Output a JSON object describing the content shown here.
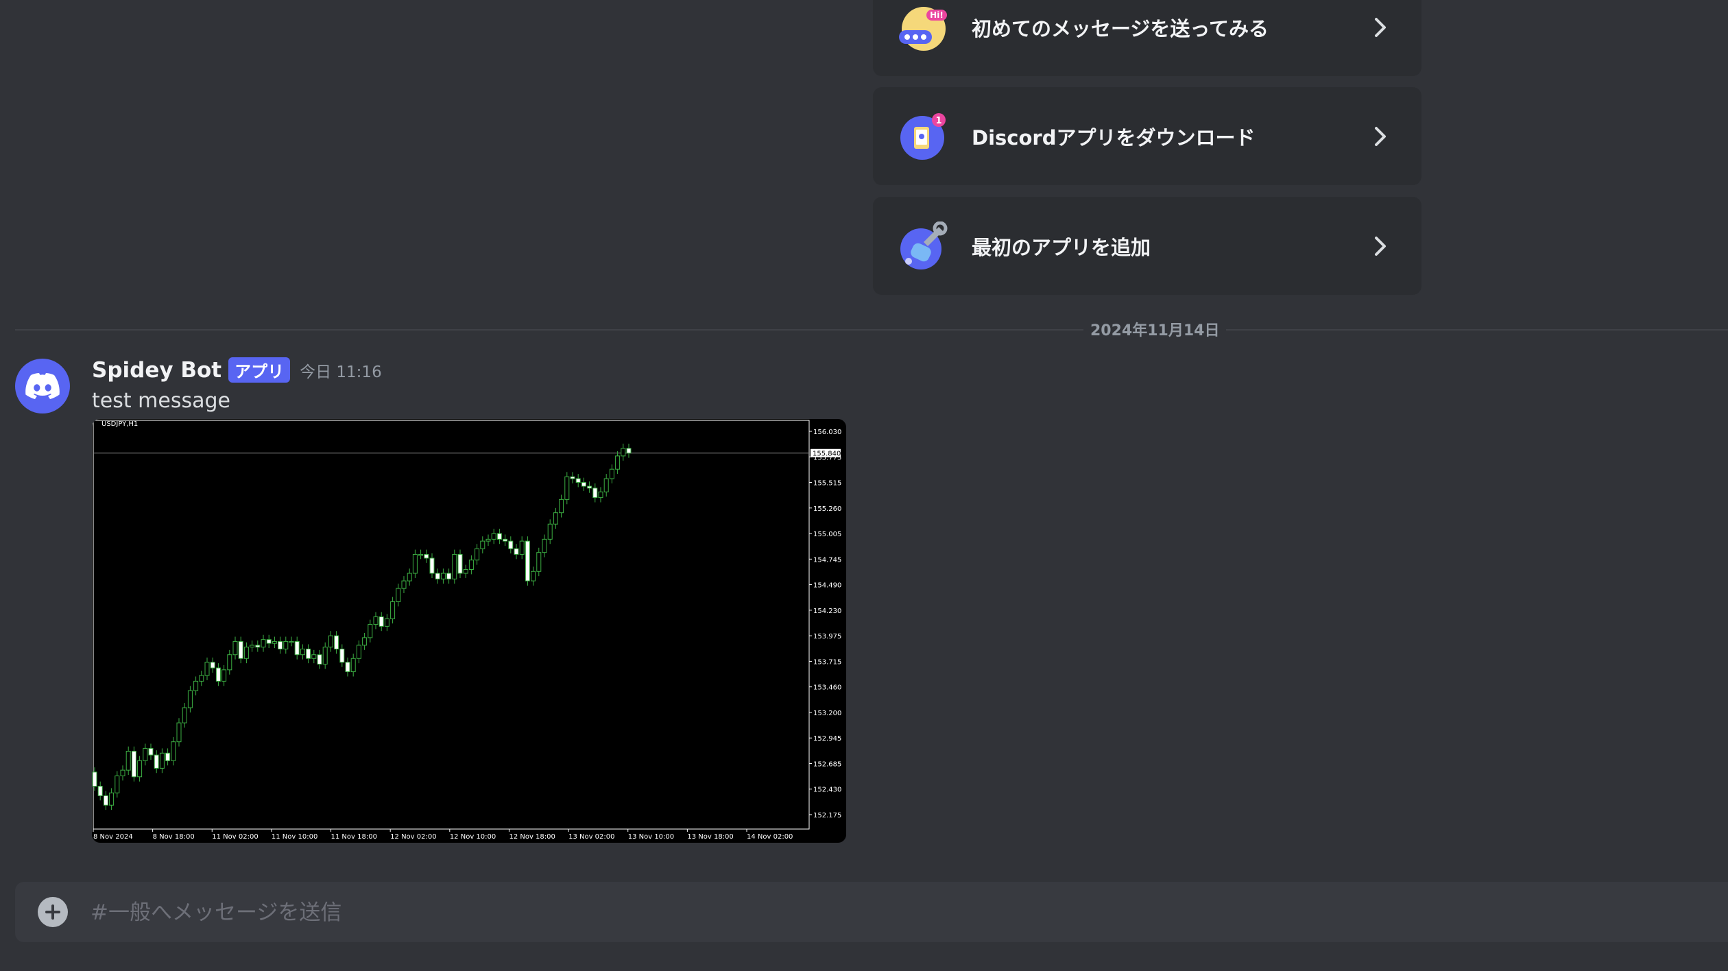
{
  "onboarding": {
    "cards": [
      {
        "label": "初めてのメッセージを送ってみる",
        "icon": "wave-chat-icon"
      },
      {
        "label": "Discordアプリをダウンロード",
        "icon": "phone-download-icon",
        "badge": "1"
      },
      {
        "label": "最初のアプリを追加",
        "icon": "wrench-app-icon"
      }
    ],
    "hi_badge": "Hi!"
  },
  "divider": {
    "date": "2024年11月14日"
  },
  "message": {
    "username": "Spidey Bot",
    "badge": "アプリ",
    "timestamp": "今日 11:16",
    "text": "test message"
  },
  "chart_data": {
    "type": "candlestick",
    "title": "USDJPY,H1",
    "current_price_label": "155.840",
    "y_ticks": [
      "156.030",
      "155.775",
      "155.515",
      "155.260",
      "155.005",
      "154.745",
      "154.490",
      "154.230",
      "153.975",
      "153.715",
      "153.460",
      "153.200",
      "152.945",
      "152.685",
      "152.430",
      "152.175"
    ],
    "x_ticks": [
      "8 Nov 2024",
      "8 Nov 18:00",
      "11 Nov 02:00",
      "11 Nov 10:00",
      "11 Nov 18:00",
      "12 Nov 02:00",
      "12 Nov 10:00",
      "12 Nov 18:00",
      "13 Nov 02:00",
      "13 Nov 10:00",
      "13 Nov 18:00",
      "14 Nov 02:00"
    ],
    "ylim": [
      152.05,
      156.1
    ],
    "grid": false,
    "colors": {
      "up": "#000000",
      "down": "#ffffff",
      "wick": "#3cb043",
      "background": "#000000",
      "text": "#ffffff"
    },
    "close": [
      152.35,
      152.25,
      152.15,
      152.28,
      152.46,
      152.52,
      152.72,
      152.45,
      152.62,
      152.75,
      152.68,
      152.54,
      152.7,
      152.62,
      152.82,
      153.02,
      153.18,
      153.36,
      153.46,
      153.52,
      153.66,
      153.6,
      153.46,
      153.58,
      153.74,
      153.88,
      153.7,
      153.82,
      153.84,
      153.82,
      153.9,
      153.86,
      153.88,
      153.8,
      153.88,
      153.88,
      153.74,
      153.8,
      153.7,
      153.74,
      153.64,
      153.82,
      153.94,
      153.8,
      153.66,
      153.56,
      153.7,
      153.84,
      153.92,
      154.06,
      154.14,
      154.04,
      154.12,
      154.3,
      154.44,
      154.52,
      154.6,
      154.8,
      154.8,
      154.76,
      154.6,
      154.54,
      154.6,
      154.54,
      154.8,
      154.6,
      154.64,
      154.74,
      154.86,
      154.94,
      154.96,
      155.02,
      154.96,
      154.94,
      154.86,
      154.8,
      154.94,
      154.52,
      154.62,
      154.82,
      154.96,
      155.12,
      155.24,
      155.38,
      155.62,
      155.6,
      155.56,
      155.52,
      155.5,
      155.4,
      155.46,
      155.6,
      155.7,
      155.84,
      155.92,
      155.87
    ]
  },
  "composer": {
    "placeholder": "#一般へメッセージを送信"
  }
}
